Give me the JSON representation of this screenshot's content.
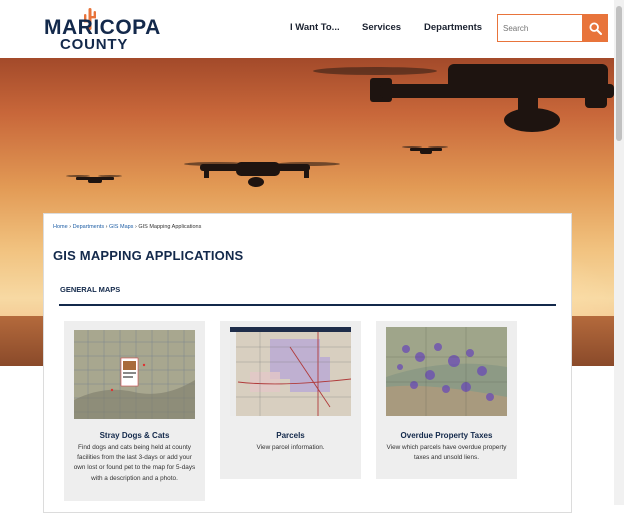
{
  "header": {
    "logo": {
      "line1": "MARICOPA",
      "line2": "COUNTY"
    },
    "nav": [
      {
        "label": "I Want To..."
      },
      {
        "label": "Services"
      },
      {
        "label": "Departments"
      }
    ],
    "search": {
      "placeholder": "Search"
    }
  },
  "breadcrumb": {
    "items": [
      "Home",
      "Departments",
      "GIS Maps"
    ],
    "sep": "›",
    "current": "GIS Mapping Applications"
  },
  "page_title": "GIS MAPPING APPLICATIONS",
  "section_title": "GENERAL MAPS",
  "tiles": [
    {
      "title": "Stray Dogs & Cats",
      "description": "Find dogs and cats being held at county facilities from the last 3-days or add your own lost or found pet to the map for 5-days with a description and a photo."
    },
    {
      "title": "Parcels",
      "description": "View parcel information."
    },
    {
      "title": "Overdue Property Taxes",
      "description": "View which parcels have overdue property taxes and unsold liens."
    }
  ],
  "colors": {
    "navy": "#13294b",
    "accent": "#e8743b",
    "link": "#1f5fa6"
  },
  "icons": [
    "cactus-icon",
    "search-icon"
  ]
}
